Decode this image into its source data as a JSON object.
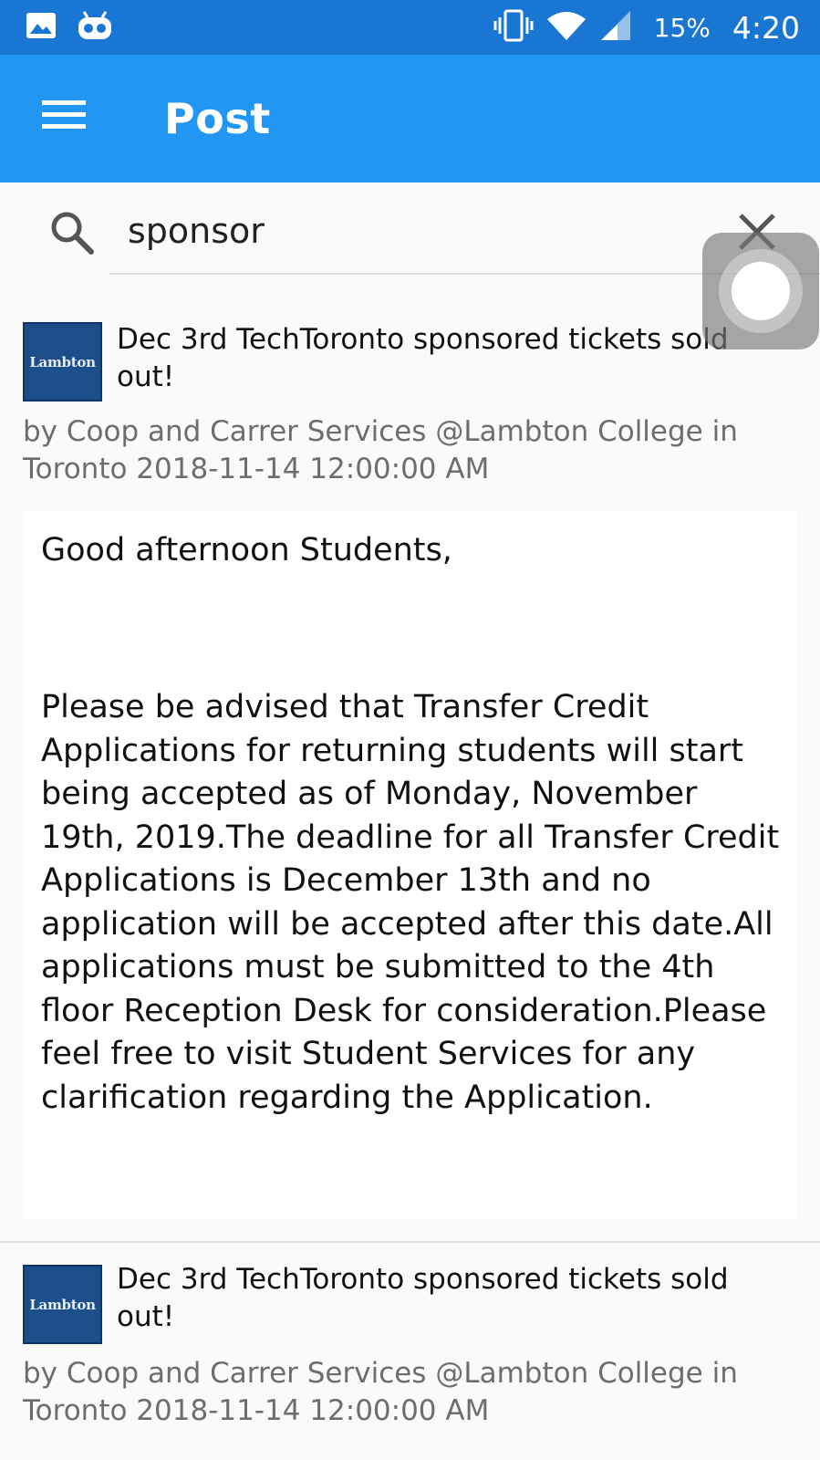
{
  "status_bar": {
    "icons": [
      "image-icon",
      "android-icon",
      "vibrate-icon",
      "wifi-icon",
      "signal-icon"
    ],
    "battery": "15%",
    "time": "4:20"
  },
  "app_bar": {
    "menu_icon": "menu-icon",
    "title": "Post"
  },
  "search": {
    "icon": "search-icon",
    "value": "sponsor",
    "clear_icon": "close-icon"
  },
  "posts": [
    {
      "logo_text": "Lambton",
      "title": "Dec 3rd TechToronto sponsored tickets sold out!",
      "meta": "by Coop and Carrer Services @Lambton College in Toronto 2018-11-14 12:00:00 AM",
      "greeting": "Good afternoon Students,",
      "body": "Please be advised that Transfer Credit Applications for returning students will start being accepted as of Monday, November 19th, 2019.The deadline for all Transfer Credit Applications is December 13th and no application will be accepted after this date.All applications must be submitted to the 4th floor Reception Desk for consideration.Please feel free to visit Student Services for any clarification regarding the Application."
    },
    {
      "logo_text": "Lambton",
      "title": "Dec 3rd TechToronto sponsored tickets sold out!",
      "meta": "by Coop and Carrer Services @Lambton College in Toronto 2018-11-14 12:00:00 AM"
    }
  ],
  "colors": {
    "status_bar": "#1976d2",
    "app_bar": "#2196f3",
    "background": "#fafafa",
    "meta_text": "#6d6d6d",
    "logo_bg": "#1b4e8a"
  }
}
